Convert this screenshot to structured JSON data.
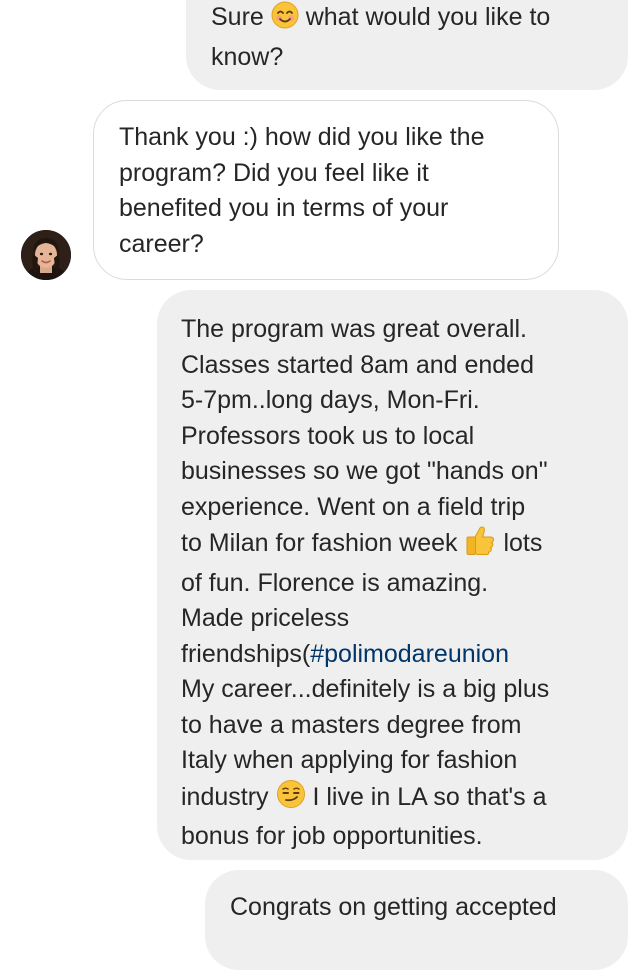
{
  "messages": [
    {
      "from": "me",
      "lines": [
        "Sure",
        "what would you like to",
        "know?"
      ]
    },
    {
      "from": "them",
      "lines": [
        "Thank you :) how did you like the",
        "program? Did you feel like it",
        "benefited you in terms of your",
        "career?"
      ]
    },
    {
      "from": "me",
      "lines": [
        "The program was great overall.",
        "Classes started 8am and ended",
        "5-7pm..long days, Mon-Fri.",
        "Professors took us to local",
        "businesses so we got \"hands on\"",
        "experience. Went on a field trip",
        "to Milan for fashion week",
        "lots",
        "of fun. Florence is amazing.",
        "Made priceless",
        "friendships(",
        "#polimodareunion",
        "My career...definitely is a big plus",
        "to have a masters degree from",
        "Italy when applying for fashion",
        "industry",
        "I live in LA so that's a",
        "bonus for job opportunities."
      ]
    },
    {
      "from": "me",
      "lines": [
        "Congrats on getting accepted"
      ]
    }
  ],
  "icons": {
    "smile": "smiling-face-emoji",
    "thumbs_up": "thumbs-up-emoji",
    "smirk": "smirking-face-emoji",
    "avatar": "contact-avatar"
  },
  "colors": {
    "sent_bubble": "#efefef",
    "received_border": "#dbdbdb",
    "hashtag": "#003569",
    "text": "#262626"
  }
}
